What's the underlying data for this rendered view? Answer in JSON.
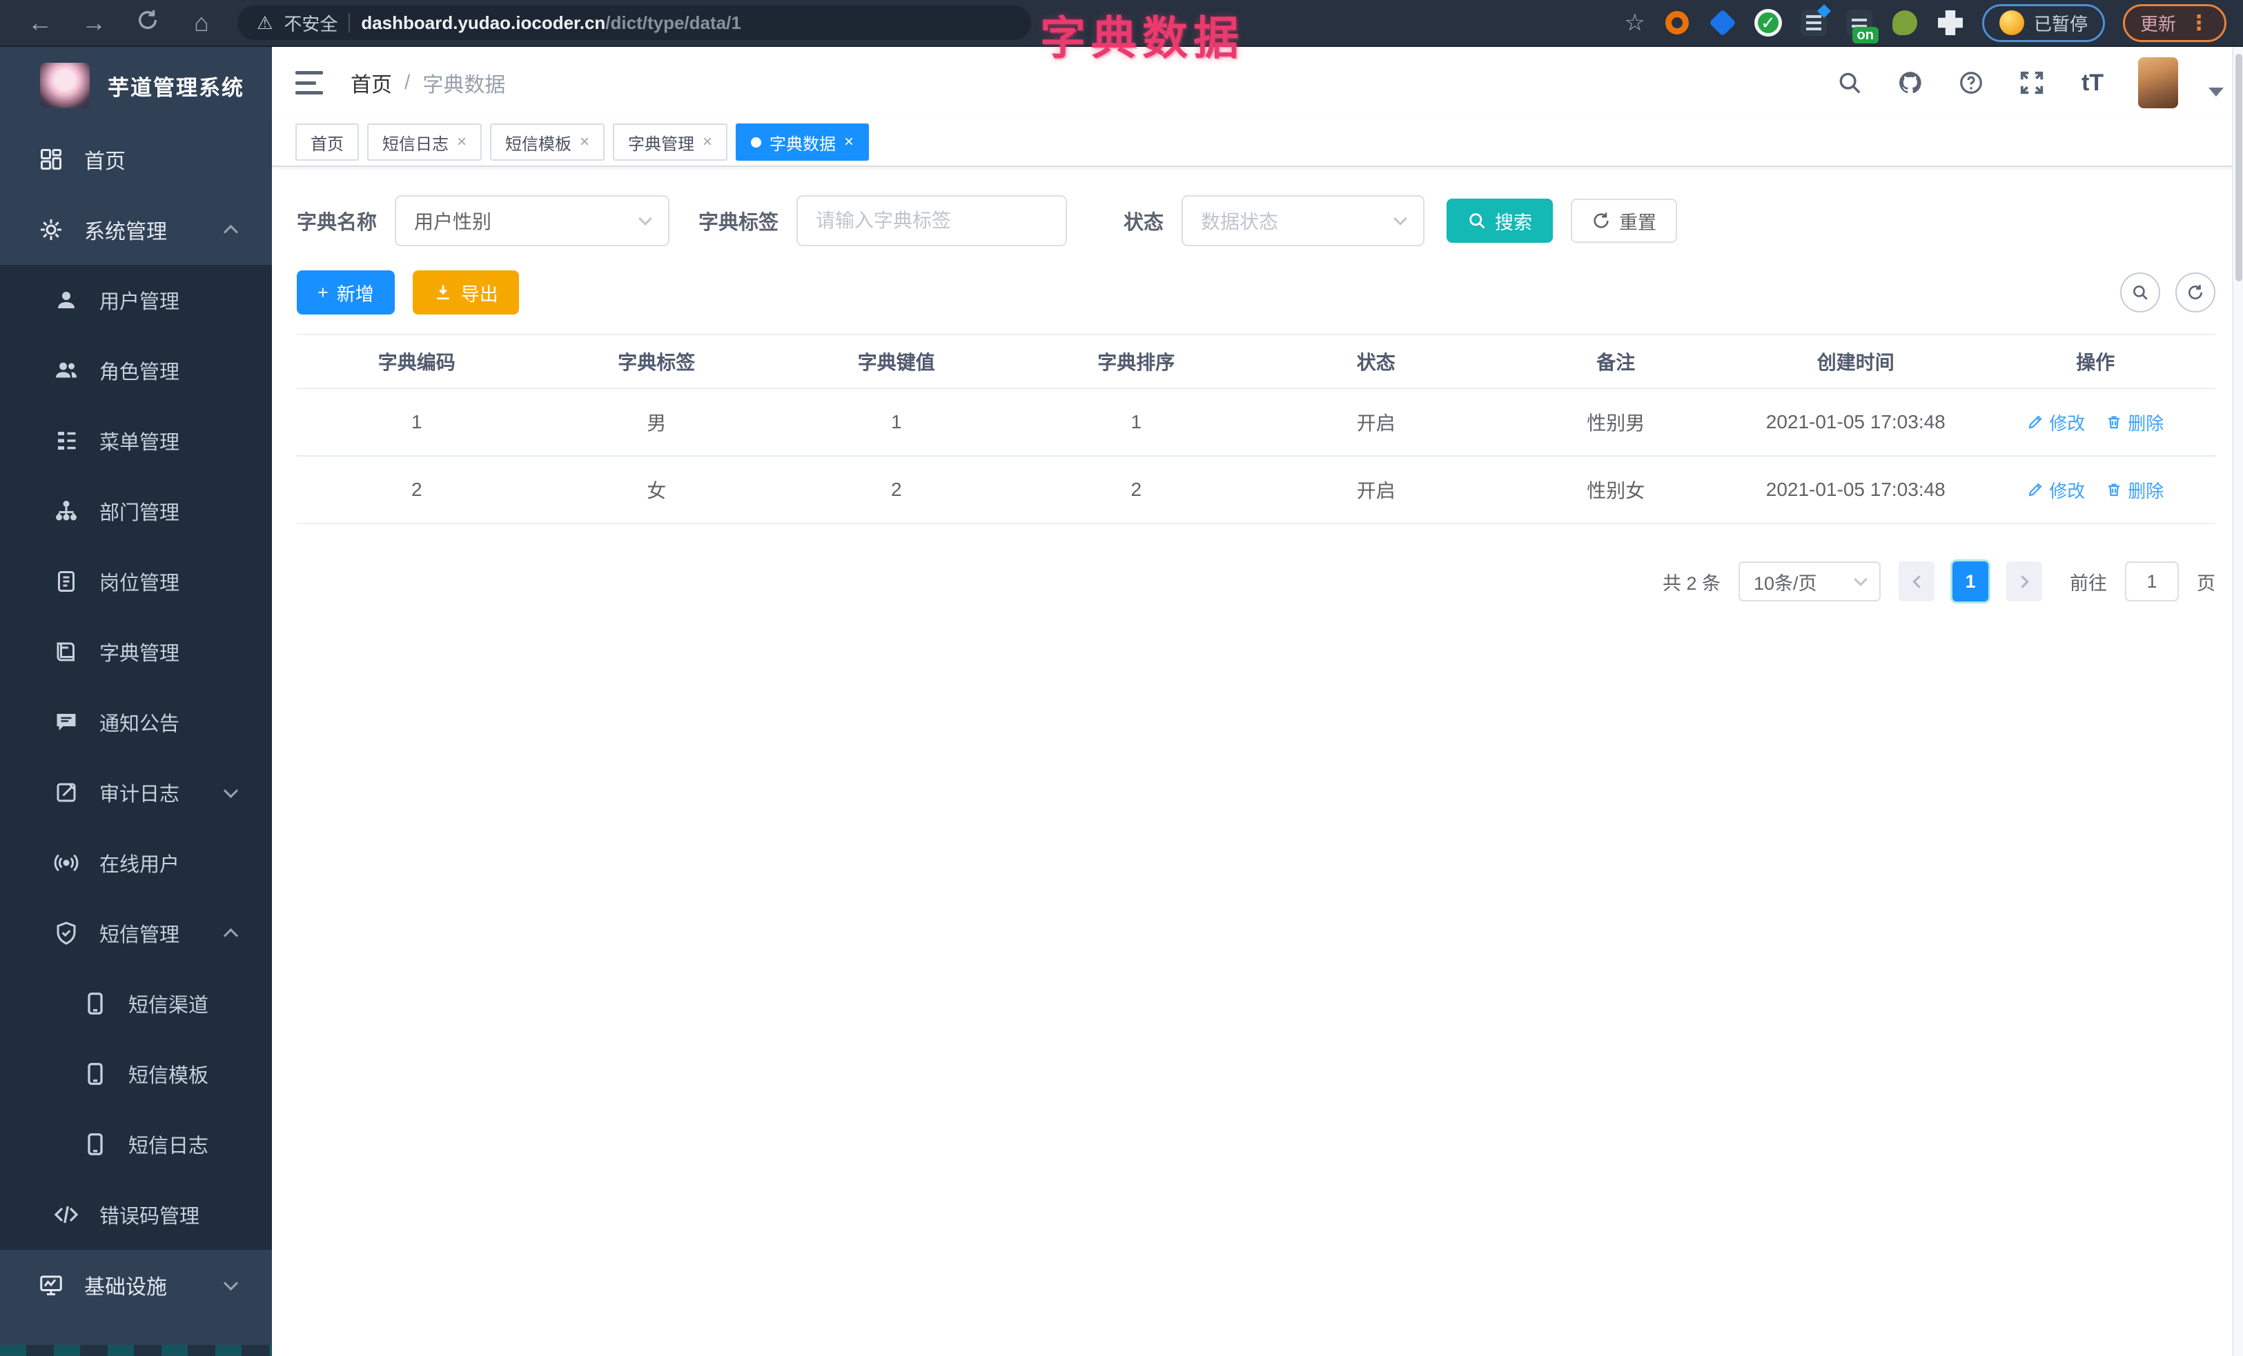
{
  "colors": {
    "accent_blue": "#1890ff",
    "teal": "#14b8b5",
    "orange": "#f7a800",
    "pink_annotation": "#ea3a6e",
    "link_blue": "#3da2ff",
    "sidebar_bg": "#304156",
    "sidebar_submenu_bg": "#1f2d3d"
  },
  "ui": {
    "close": "×",
    "kebab": "⋮",
    "back": "←",
    "forward": "→",
    "home": "⌂",
    "warning": "⚠",
    "star": "☆",
    "plus": "+",
    "question": "?"
  },
  "browser": {
    "security_label": "不安全",
    "url_domain": "dashboard.yudao.iocoder.cn",
    "url_path": "/dict/type/data/1",
    "ext_on_badge": "on",
    "paused_badge": "已暂停",
    "update_badge": "更新"
  },
  "annotation": {
    "title": "字典数据"
  },
  "sidebar": {
    "app_title": "芋道管理系统",
    "items": [
      {
        "label": "首页"
      },
      {
        "label": "系统管理"
      },
      {
        "label": "用户管理"
      },
      {
        "label": "角色管理"
      },
      {
        "label": "菜单管理"
      },
      {
        "label": "部门管理"
      },
      {
        "label": "岗位管理"
      },
      {
        "label": "字典管理"
      },
      {
        "label": "通知公告"
      },
      {
        "label": "审计日志"
      },
      {
        "label": "在线用户"
      },
      {
        "label": "短信管理"
      },
      {
        "label": "短信渠道"
      },
      {
        "label": "短信模板"
      },
      {
        "label": "短信日志"
      },
      {
        "label": "错误码管理"
      },
      {
        "label": "基础设施"
      }
    ]
  },
  "header": {
    "breadcrumb": {
      "home": "首页",
      "sep": "/",
      "current": "字典数据"
    },
    "font_icon": "tT"
  },
  "tabs": [
    {
      "label": "首页"
    },
    {
      "label": "短信日志"
    },
    {
      "label": "短信模板"
    },
    {
      "label": "字典管理"
    },
    {
      "label": "字典数据"
    }
  ],
  "filters": {
    "name_label": "字典名称",
    "name_value": "用户性别",
    "tag_label": "字典标签",
    "tag_placeholder": "请输入字典标签",
    "status_label": "状态",
    "status_placeholder": "数据状态",
    "search_label": "搜索",
    "reset_label": "重置"
  },
  "toolbar": {
    "add_label": "新增",
    "export_label": "导出"
  },
  "table": {
    "headers": [
      "字典编码",
      "字典标签",
      "字典键值",
      "字典排序",
      "状态",
      "备注",
      "创建时间",
      "操作"
    ],
    "rows": [
      [
        "1",
        "男",
        "1",
        "1",
        "开启",
        "性别男",
        "2021-01-05 17:03:48"
      ],
      [
        "2",
        "女",
        "2",
        "2",
        "开启",
        "性别女",
        "2021-01-05 17:03:48"
      ]
    ],
    "actions": {
      "edit": "修改",
      "delete": "删除"
    }
  },
  "pagination": {
    "total": "共 2 条",
    "page_size": "10条/页",
    "current_page": "1",
    "goto_label": "前往",
    "goto_value": "1",
    "page_unit": "页"
  }
}
